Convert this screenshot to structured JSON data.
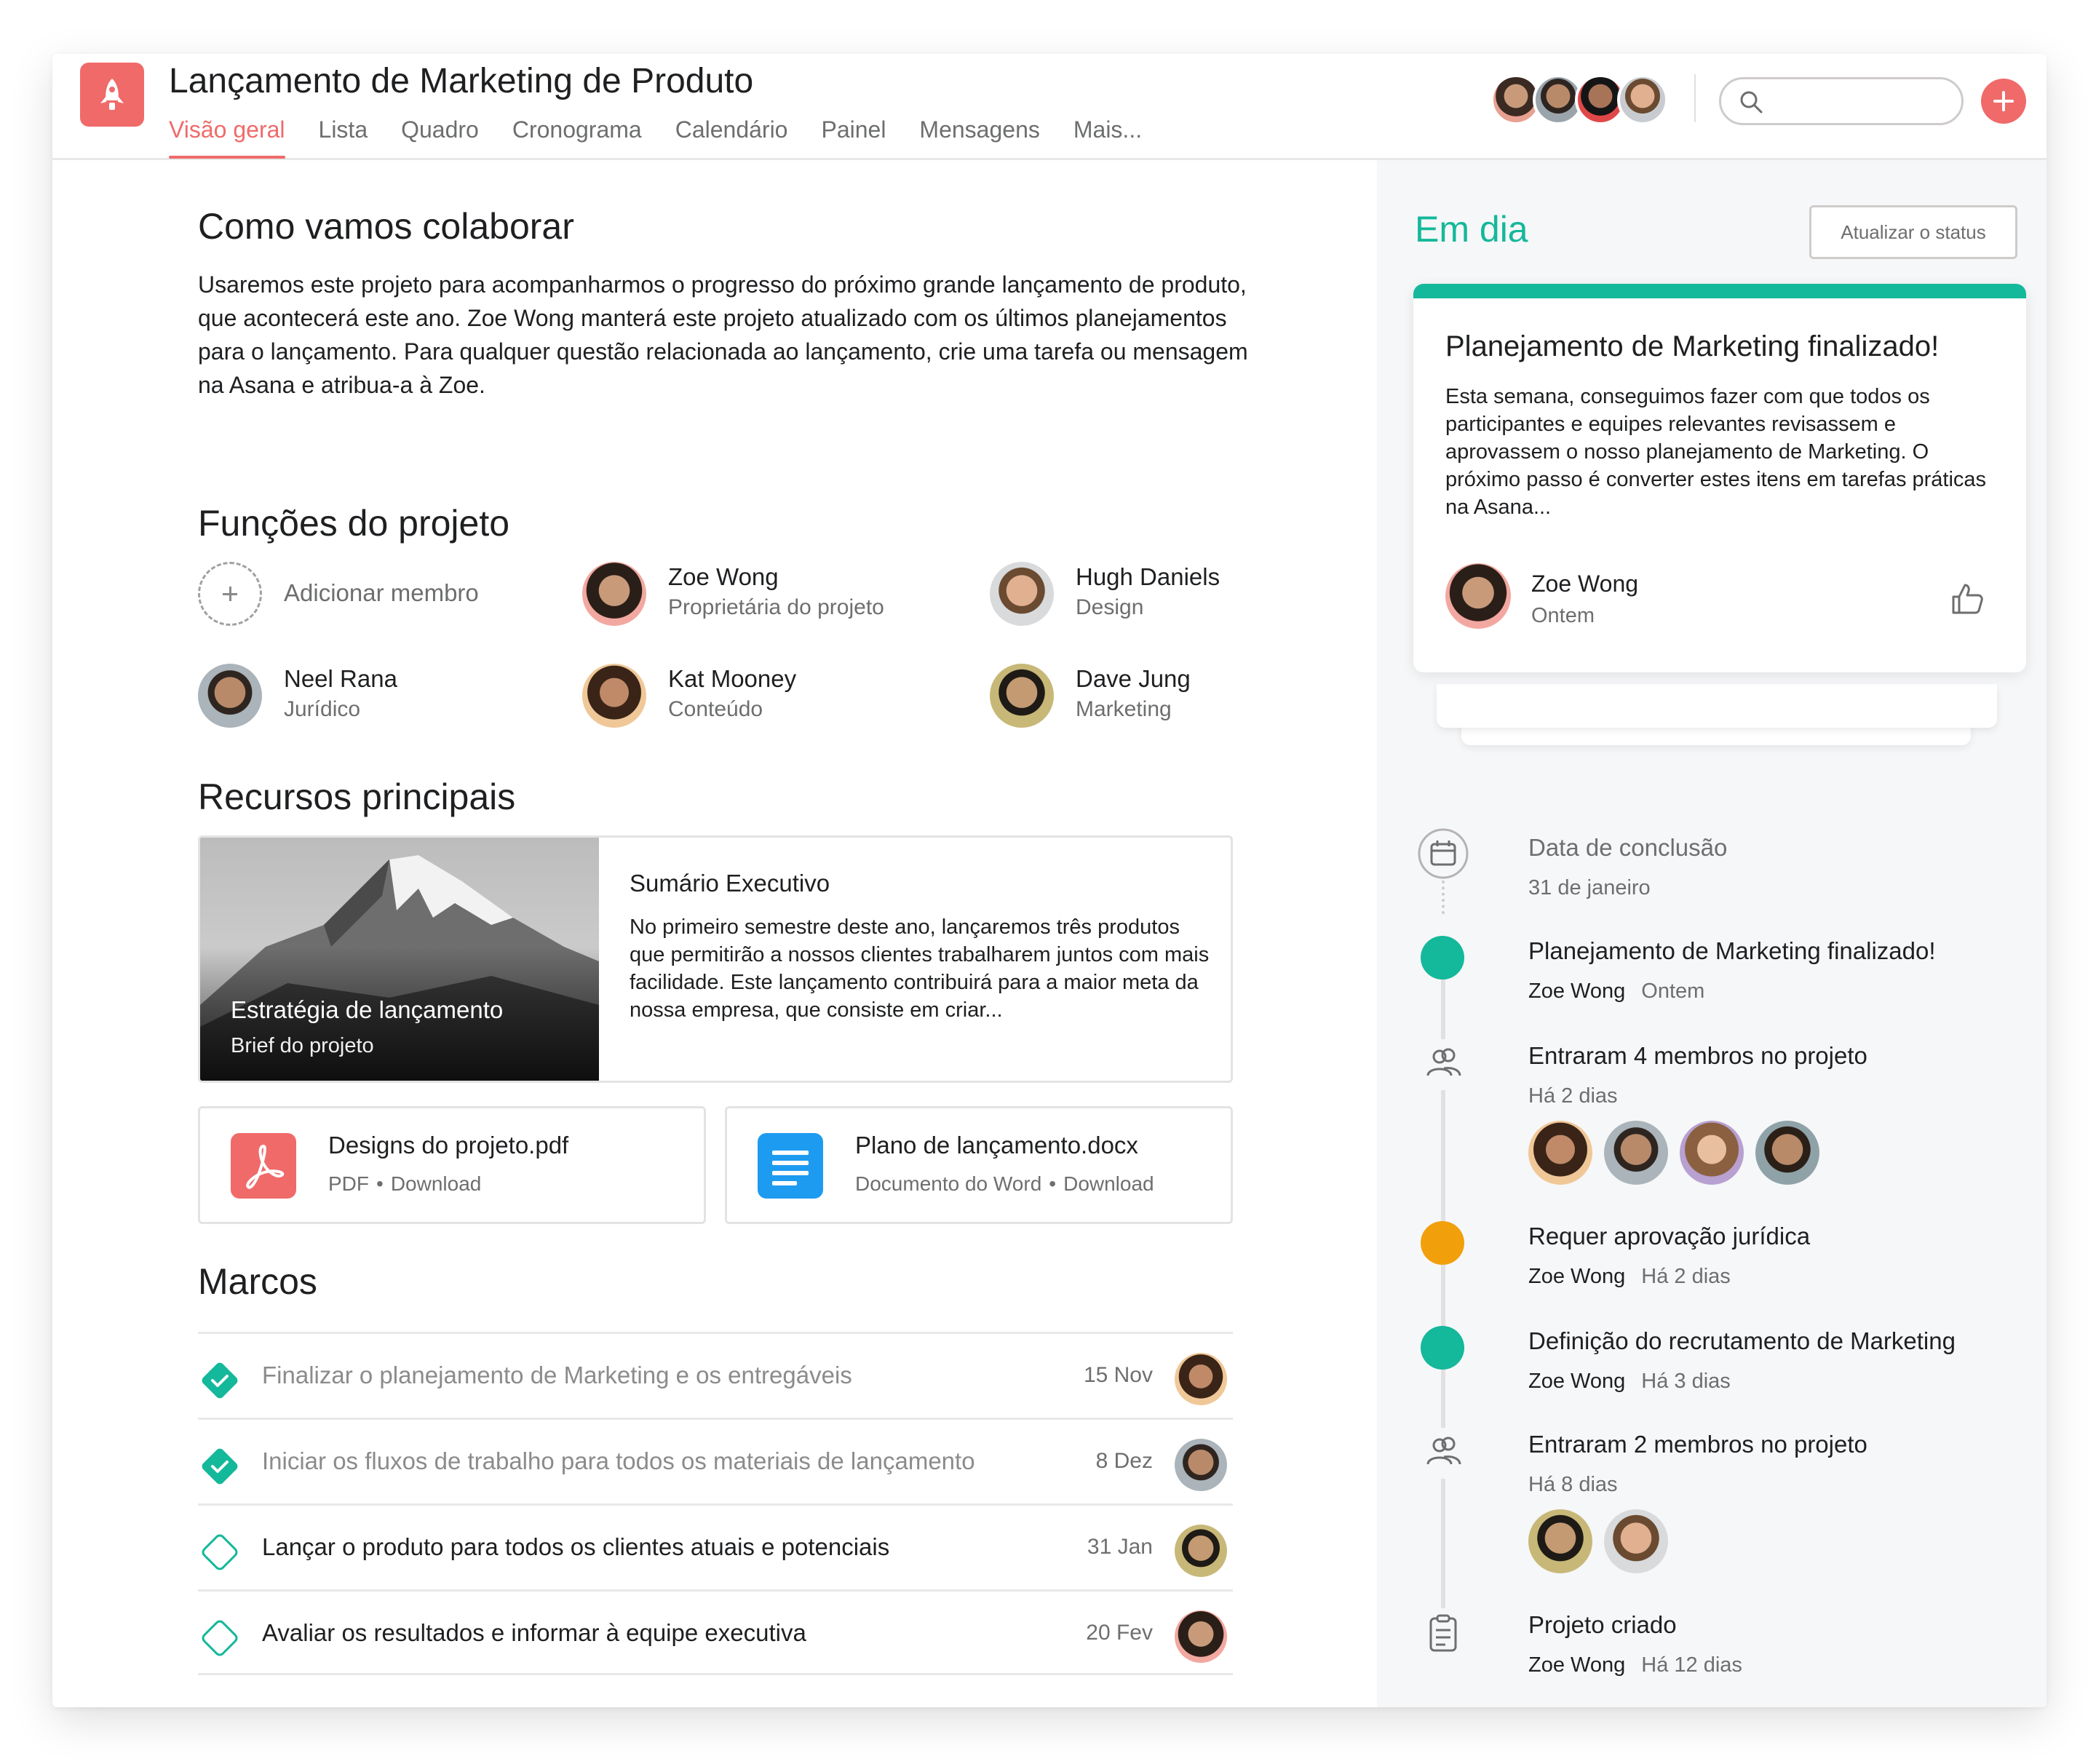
{
  "project": {
    "title": "Lançamento de Marketing de Produto"
  },
  "tabs": [
    "Visão geral",
    "Lista",
    "Quadro",
    "Cronograma",
    "Calendário",
    "Painel",
    "Mensagens",
    "Mais..."
  ],
  "colors": {
    "accent": "#f06a6a",
    "on_track": "#14b89a",
    "warning": "#f1a00b",
    "word_blue": "#1d9bf0"
  },
  "search": {
    "placeholder": "",
    "value": ""
  },
  "collaborate": {
    "title": "Como vamos colaborar",
    "text": "Usaremos este projeto para acompanharmos o progresso do próximo grande lançamento de produto, que acontecerá este ano. Zoe Wong manterá este projeto atualizado com os últimos planejamentos para o lançamento. Para qualquer questão relacionada ao lançamento, crie uma tarefa ou mensagem na Asana e atribua-a à Zoe."
  },
  "roles": {
    "title": "Funções do projeto",
    "add_label": "Adicionar membro",
    "members": [
      {
        "name": "Zoe Wong",
        "role": "Proprietária do projeto"
      },
      {
        "name": "Hugh Daniels",
        "role": "Design"
      },
      {
        "name": "Neel Rana",
        "role": "Jurídico"
      },
      {
        "name": "Kat Mooney",
        "role": "Conteúdo"
      },
      {
        "name": "Dave Jung",
        "role": "Marketing"
      }
    ]
  },
  "resources": {
    "title": "Recursos principais",
    "brief": {
      "image_title": "Estratégia de lançamento",
      "image_sub": "Brief do projeto",
      "title": "Sumário Executivo",
      "text": "No primeiro semestre deste ano, lançaremos três produtos que permitirão a nossos clientes trabalharem juntos com mais facilidade. Este lançamento contribuirá para a maior meta da nossa empresa, que consiste em criar..."
    },
    "files": [
      {
        "name": "Designs do projeto.pdf",
        "type": "PDF",
        "action": "Download",
        "icon": "pdf-icon"
      },
      {
        "name": "Plano de lançamento.docx",
        "type": "Documento do Word",
        "action": "Download",
        "icon": "word-doc-icon"
      }
    ]
  },
  "milestones": {
    "title": "Marcos",
    "items": [
      {
        "title": "Finalizar o planejamento de Marketing e os entregáveis",
        "date": "15 Nov",
        "done": true
      },
      {
        "title": "Iniciar os fluxos de trabalho para todos os materiais de lançamento",
        "date": "8 Dez",
        "done": true
      },
      {
        "title": "Lançar o produto para todos os clientes atuais e potenciais",
        "date": "31 Jan",
        "done": false
      },
      {
        "title": "Avaliar os resultados e informar à equipe executiva",
        "date": "20 Fev",
        "done": false
      }
    ]
  },
  "status": {
    "label": "Em dia",
    "update_button": "Atualizar o status",
    "card": {
      "title": "Planejamento de Marketing finalizado!",
      "text": "Esta semana, conseguimos fazer com que todos os participantes e equipes relevantes revisassem e aprovassem o nosso planejamento de Marketing. O próximo passo é converter estes itens em tarefas práticas na Asana...",
      "author": "Zoe Wong",
      "time": "Ontem"
    }
  },
  "timeline": [
    {
      "title": "Data de conclusão",
      "sub": "31 de janeiro"
    },
    {
      "title": "Planejamento de Marketing finalizado!",
      "author": "Zoe Wong",
      "time": "Ontem"
    },
    {
      "title": "Entraram 4 membros no projeto",
      "time": "Há 2 dias"
    },
    {
      "title": "Requer aprovação jurídica",
      "author": "Zoe Wong",
      "time": "Há 2 dias"
    },
    {
      "title": "Definição do recrutamento de Marketing",
      "author": "Zoe Wong",
      "time": "Há 3 dias"
    },
    {
      "title": "Entraram 2 membros no projeto",
      "time": "Há 8 dias"
    },
    {
      "title": "Projeto criado",
      "author": "Zoe Wong",
      "time": "Há 12 dias"
    }
  ]
}
